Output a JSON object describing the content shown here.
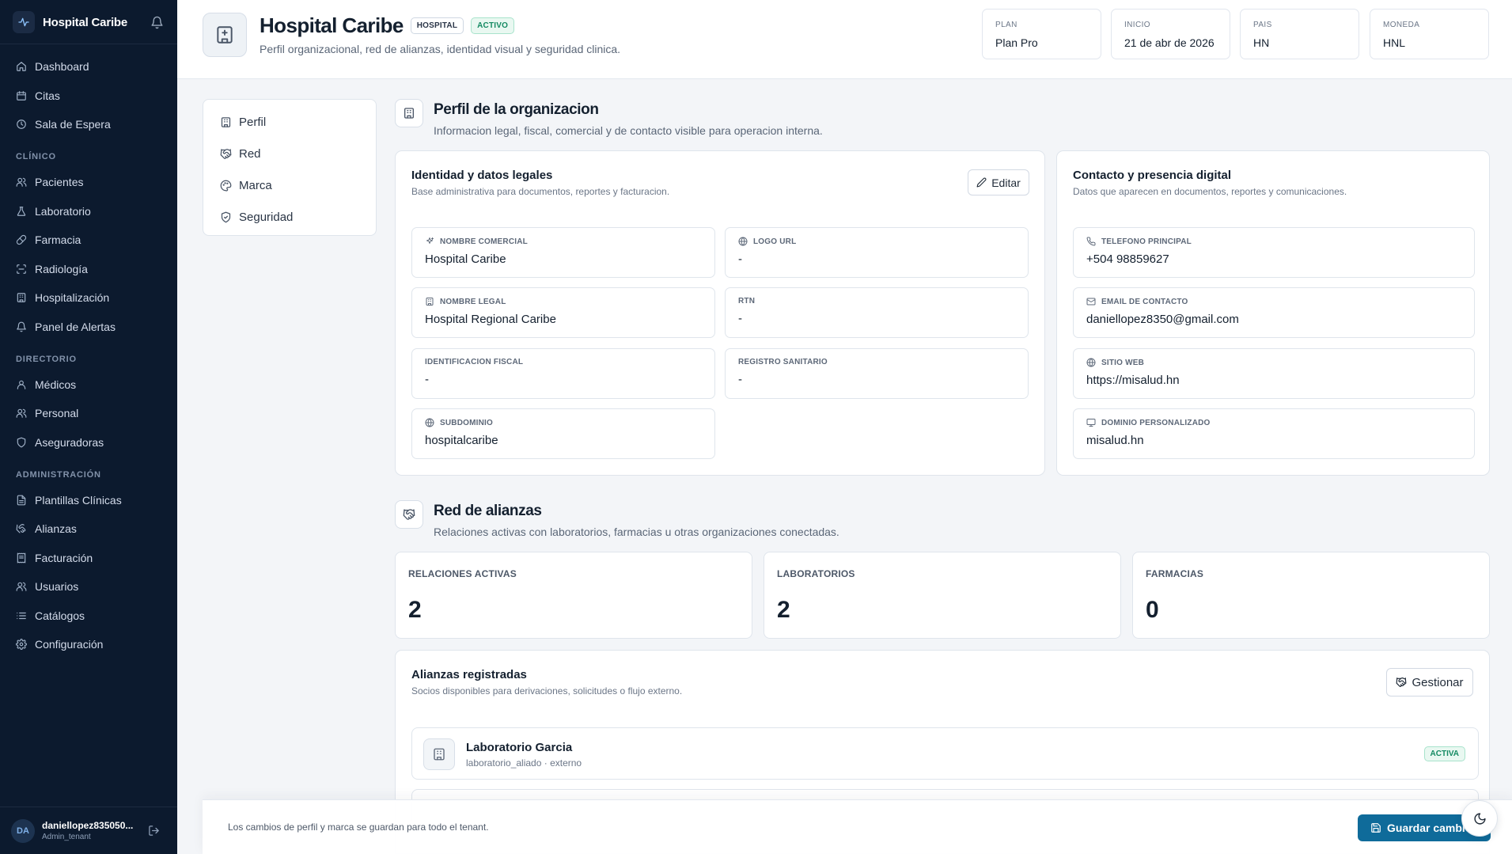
{
  "app": {
    "name": "Hospital Caribe"
  },
  "sidebar": {
    "items": [
      {
        "type": "link",
        "label": "Dashboard",
        "icon": "home"
      },
      {
        "type": "link",
        "label": "Citas",
        "icon": "calendar"
      },
      {
        "type": "link",
        "label": "Sala de Espera",
        "icon": "clock"
      },
      {
        "type": "section",
        "label": "CLÍNICO"
      },
      {
        "type": "link",
        "label": "Pacientes",
        "icon": "users"
      },
      {
        "type": "link",
        "label": "Laboratorio",
        "icon": "flask"
      },
      {
        "type": "link",
        "label": "Farmacia",
        "icon": "pill"
      },
      {
        "type": "link",
        "label": "Radiología",
        "icon": "scan"
      },
      {
        "type": "link",
        "label": "Hospitalización",
        "icon": "building"
      },
      {
        "type": "link",
        "label": "Panel de Alertas",
        "icon": "bell"
      },
      {
        "type": "section",
        "label": "DIRECTORIO"
      },
      {
        "type": "link",
        "label": "Médicos",
        "icon": "user"
      },
      {
        "type": "link",
        "label": "Personal",
        "icon": "users"
      },
      {
        "type": "link",
        "label": "Aseguradoras",
        "icon": "shield"
      },
      {
        "type": "section",
        "label": "ADMINISTRACIÓN"
      },
      {
        "type": "link",
        "label": "Plantillas Clínicas",
        "icon": "file"
      },
      {
        "type": "link",
        "label": "Alianzas",
        "icon": "handshake"
      },
      {
        "type": "link",
        "label": "Facturación",
        "icon": "receipt"
      },
      {
        "type": "link",
        "label": "Usuarios",
        "icon": "users"
      },
      {
        "type": "link",
        "label": "Catálogos",
        "icon": "list"
      },
      {
        "type": "link",
        "label": "Configuración",
        "icon": "gear"
      }
    ],
    "user": {
      "initials": "DA",
      "name": "daniellopez835050...",
      "role": "Admin_tenant"
    }
  },
  "header": {
    "title": "Hospital Caribe",
    "type_badge": "HOSPITAL",
    "status_badge": "ACTIVO",
    "subtitle": "Perfil organizacional, red de alianzas, identidad visual y seguridad clinica.",
    "meta": [
      {
        "label": "PLAN",
        "value": "Plan Pro"
      },
      {
        "label": "INICIO",
        "value": "21 de abr de 2026"
      },
      {
        "label": "PAIS",
        "value": "HN"
      },
      {
        "label": "MONEDA",
        "value": "HNL"
      }
    ]
  },
  "tabs": [
    {
      "label": "Perfil",
      "icon": "building"
    },
    {
      "label": "Red",
      "icon": "handshake"
    },
    {
      "label": "Marca",
      "icon": "palette"
    },
    {
      "label": "Seguridad",
      "icon": "shield"
    }
  ],
  "profile": {
    "title": "Perfil de la organizacion",
    "subtitle": "Informacion legal, fiscal, comercial y de contacto visible para operacion interna.",
    "legal": {
      "title": "Identidad y datos legales",
      "subtitle": "Base administrativa para documentos, reportes y facturacion.",
      "edit_label": "Editar",
      "fields": [
        {
          "label": "NOMBRE COMERCIAL",
          "value": "Hospital Caribe",
          "icon": "sparkle"
        },
        {
          "label": "LOGO URL",
          "value": "-",
          "icon": "globe"
        },
        {
          "label": "NOMBRE LEGAL",
          "value": "Hospital Regional Caribe",
          "icon": "building"
        },
        {
          "label": "RTN",
          "value": "-",
          "icon": ""
        },
        {
          "label": "IDENTIFICACION FISCAL",
          "value": "-",
          "icon": ""
        },
        {
          "label": "REGISTRO SANITARIO",
          "value": "-",
          "icon": ""
        },
        {
          "label": "SUBDOMINIO",
          "value": "hospitalcaribe",
          "icon": "globe"
        }
      ]
    },
    "contact": {
      "title": "Contacto y presencia digital",
      "subtitle": "Datos que aparecen en documentos, reportes y comunicaciones.",
      "fields": [
        {
          "label": "TELEFONO PRINCIPAL",
          "value": "+504 98859627",
          "icon": "phone"
        },
        {
          "label": "EMAIL DE CONTACTO",
          "value": "daniellopez8350@gmail.com",
          "icon": "mail"
        },
        {
          "label": "SITIO WEB",
          "value": "https://misalud.hn",
          "icon": "globe"
        },
        {
          "label": "DOMINIO PERSONALIZADO",
          "value": "misalud.hn",
          "icon": "monitor"
        }
      ]
    }
  },
  "network": {
    "title": "Red de alianzas",
    "subtitle": "Relaciones activas con laboratorios, farmacias u otras organizaciones conectadas.",
    "stats": [
      {
        "label": "RELACIONES ACTIVAS",
        "value": "2"
      },
      {
        "label": "LABORATORIOS",
        "value": "2"
      },
      {
        "label": "FARMACIAS",
        "value": "0"
      }
    ],
    "alliances": {
      "title": "Alianzas registradas",
      "subtitle": "Socios disponibles para derivaciones, solicitudes o flujo externo.",
      "manage_label": "Gestionar",
      "items": [
        {
          "name": "Laboratorio Garcia",
          "meta": "laboratorio_aliado · externo",
          "status": "ACTIVA"
        }
      ]
    }
  },
  "footer": {
    "note": "Los cambios de perfil y marca se guardan para todo el tenant.",
    "save_label": "Guardar cambios"
  }
}
